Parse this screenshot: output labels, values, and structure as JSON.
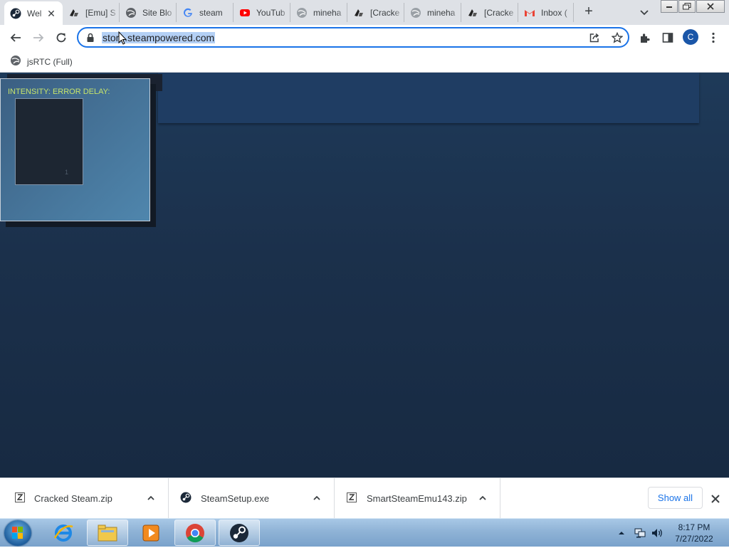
{
  "tabs": [
    {
      "title": "Wel",
      "icon": "steam-icon",
      "active": true
    },
    {
      "title": "[Emu] S",
      "icon": "cracked-icon"
    },
    {
      "title": "Site Blo",
      "icon": "globe-icon"
    },
    {
      "title": "steam",
      "icon": "google-icon"
    },
    {
      "title": "YouTub",
      "icon": "youtube-icon"
    },
    {
      "title": "mineha",
      "icon": "globe-icon"
    },
    {
      "title": "[Cracke",
      "icon": "cracked-icon"
    },
    {
      "title": "mineha",
      "icon": "globe-icon"
    },
    {
      "title": "[Cracke",
      "icon": "cracked-icon"
    },
    {
      "title": "Inbox (",
      "icon": "gmail-icon"
    }
  ],
  "toolbar": {
    "url": "store.steampowered.com",
    "profile_initial": "C"
  },
  "bookmarks": [
    {
      "title": "jsRTC (Full)"
    }
  ],
  "page": {
    "intensity_label": "INTENSITY: ERROR DELAY:",
    "box_value": "1"
  },
  "downloads": {
    "items": [
      {
        "name": "Cracked Steam.zip",
        "icon": "zip-icon"
      },
      {
        "name": "SteamSetup.exe",
        "icon": "steam-icon"
      },
      {
        "name": "SmartSteamEmu143.zip",
        "icon": "zip-icon"
      }
    ],
    "show_all": "Show all"
  },
  "taskbar": {
    "time": "8:17 PM",
    "date": "7/27/2022"
  },
  "colors": {
    "accent": "#1a73e8",
    "page_bg": "#1b304b",
    "intensity_text": "#c6e46b"
  }
}
